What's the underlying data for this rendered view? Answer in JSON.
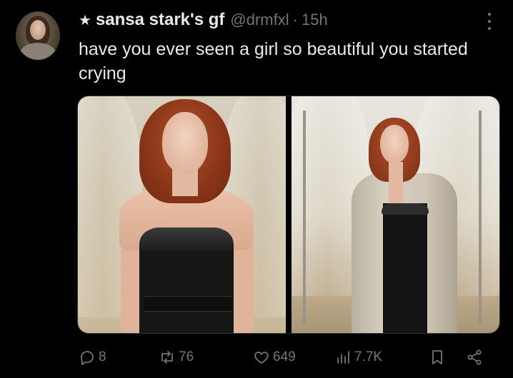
{
  "tweet": {
    "star": "★",
    "display_name": "sansa stark's gf",
    "handle": "@drmfxl",
    "separator": "·",
    "time": "15h",
    "text": "have you ever seen a girl so beautiful you started crying"
  },
  "actions": {
    "replies": "8",
    "retweets": "76",
    "likes": "649",
    "views": "7.7K"
  },
  "icons": {
    "reply": "reply-icon",
    "retweet": "retweet-icon",
    "like": "heart-icon",
    "views": "views-icon",
    "bookmark": "bookmark-icon",
    "share": "share-icon",
    "more": "more-icon"
  },
  "colors": {
    "background": "#000000",
    "text": "#e7e9ea",
    "muted": "#71767b",
    "border": "#2f3336"
  }
}
